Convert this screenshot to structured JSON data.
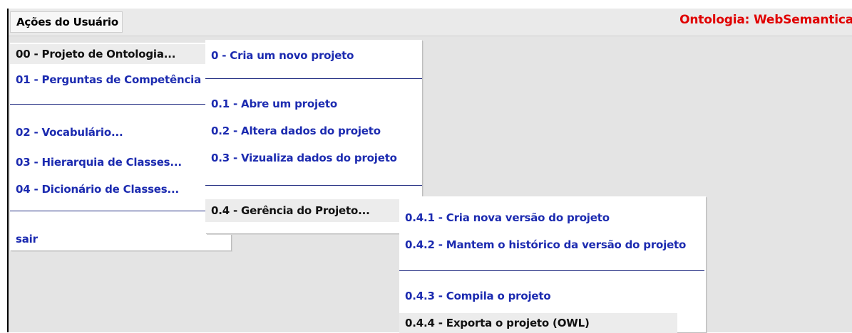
{
  "menubar": {
    "title": "Ações do Usuário",
    "ontology_label": "Ontologia: WebSemantica"
  },
  "main_menu": {
    "items": [
      "00 - Projeto de Ontologia...",
      "01 - Perguntas de Competência",
      "02 - Vocabulário...",
      "03 - Hierarquia de Classes...",
      "04 - Dicionário de Classes...",
      "sair"
    ]
  },
  "project_menu": {
    "items": [
      "0 - Cria um novo projeto",
      "0.1 - Abre um projeto",
      "0.2 - Altera dados do projeto",
      "0.3 - Vizualiza dados do projeto",
      "0.4 - Gerência do Projeto..."
    ]
  },
  "management_menu": {
    "items": [
      "0.4.1 - Cria nova versão do projeto",
      "0.4.2 - Mantem o histórico da versão do projeto",
      "0.4.3 - Compila o projeto",
      "0.4.4 - Exporta o projeto (OWL)"
    ]
  },
  "colors": {
    "menu_text": "#1c2bb0",
    "ontology_label": "#e00000",
    "separator": "#1f2a80",
    "highlight": "#ececec"
  }
}
